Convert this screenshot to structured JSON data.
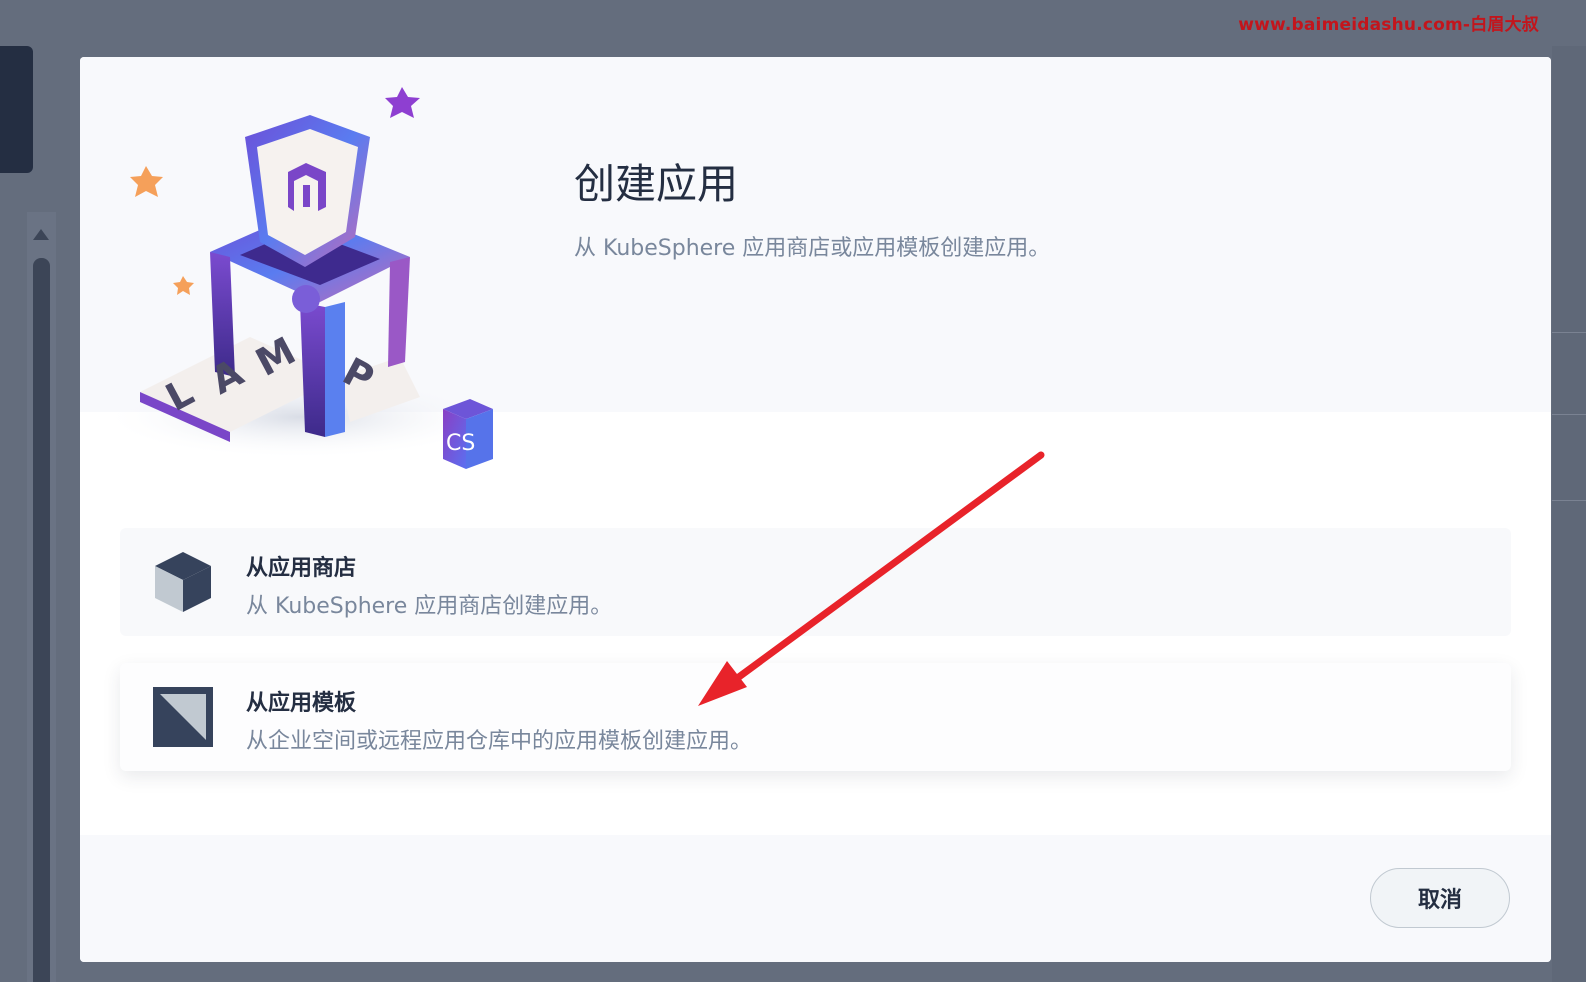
{
  "watermark": "www.baimeidashu.com-白眉大叔",
  "modal": {
    "title": "创建应用",
    "description": "从 KubeSphere 应用商店或应用模板创建应用。",
    "illustration_letters": [
      "L",
      "A",
      "M",
      "P"
    ],
    "illustration_badge": "CS"
  },
  "options": [
    {
      "id": "app-store",
      "title": "从应用商店",
      "description": "从 KubeSphere 应用商店创建应用。",
      "icon": "cube-icon"
    },
    {
      "id": "app-template",
      "title": "从应用模板",
      "description": "从企业空间或远程应用仓库中的应用模板创建应用。",
      "icon": "template-icon"
    }
  ],
  "footer": {
    "cancel_label": "取消"
  },
  "colors": {
    "overlay": "#646d7d",
    "title": "#242e42",
    "muted": "#79879c",
    "arrow": "#e8232a",
    "watermark": "#c3151c"
  }
}
